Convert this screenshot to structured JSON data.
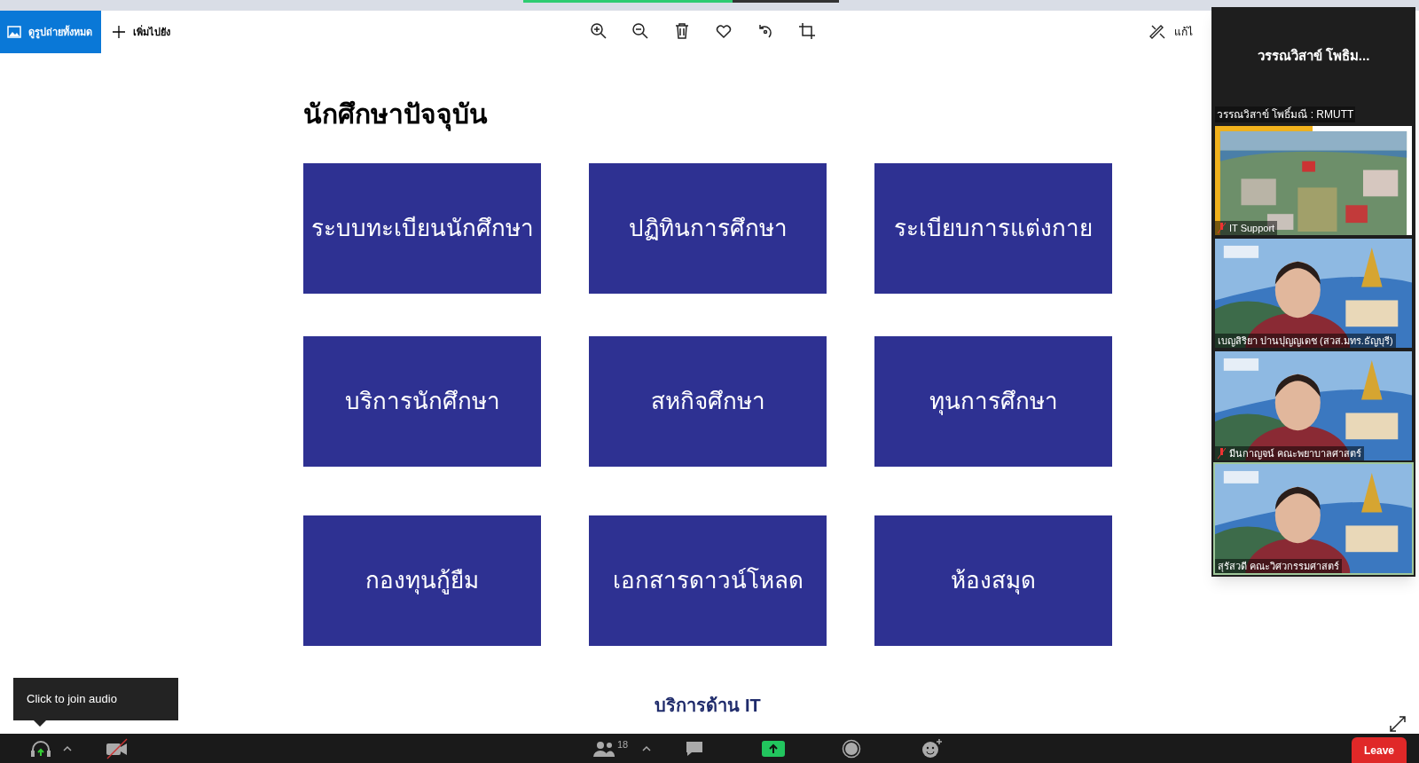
{
  "photos_toolbar": {
    "buttons": [
      {
        "label": "ดูรูปถ่ายทั้งหมด",
        "selected": true
      },
      {
        "label": "เพิ่มไปยัง",
        "selected": false
      }
    ],
    "edit_label": "แก้ไ"
  },
  "slide": {
    "title": "นักศึกษาปัจจุบัน",
    "tiles": [
      "ระบบทะเบียนนักศึกษา",
      "ปฏิทินการศึกษา",
      "ระเบียบการแต่งกาย",
      "บริการนักศึกษา",
      "สหกิจศึกษา",
      "ทุนการศึกษา",
      "กองทุนกู้ยืม",
      "เอกสารดาวน์โหลด",
      "ห้องสมุด"
    ],
    "footer": "บริการด้าน IT"
  },
  "video_panel": {
    "header_name": "วรรณวิสาข์ โพธิม...",
    "share_label": "วรรณวิสาข์ โพธิ์มณี : RMUTT",
    "tiles": [
      {
        "kind": "campus",
        "name": "IT Support",
        "muted": true,
        "active": false
      },
      {
        "kind": "person",
        "name": "เบญสิริยา ปานปุญญเดช (สวส.มทร.ธัญบุรี)",
        "muted": false,
        "active": false
      },
      {
        "kind": "person",
        "name": "มีนกาญจน์ คณะพยาบาลศาสตร์",
        "muted": true,
        "active": false
      },
      {
        "kind": "person",
        "name": "สุรัสวดี คณะวิศวกรรมศาสตร์",
        "muted": false,
        "active": true
      }
    ]
  },
  "tooltip": "Click to join audio",
  "meeting_bar": {
    "participants_count": "18",
    "leave_label": "Leave"
  }
}
